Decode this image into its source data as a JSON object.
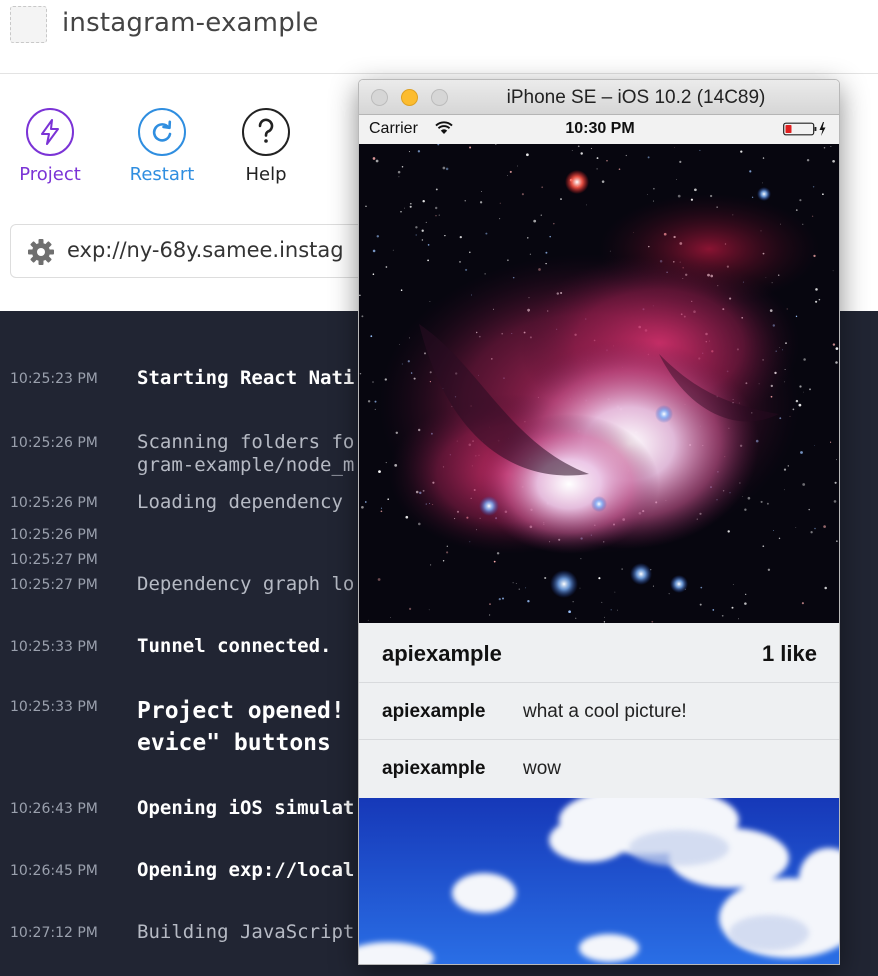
{
  "app": {
    "project_name": "instagram-example"
  },
  "toolbar": {
    "project_label": "Project",
    "restart_label": "Restart",
    "help_label": "Help",
    "url": "exp://ny-68y.samee.instag"
  },
  "colors": {
    "project_accent": "#7b33d6",
    "restart_accent": "#2f8ee0",
    "log_background": "#212533",
    "post_panel": "#eef0f2"
  },
  "log": [
    {
      "time": "10:25:23 PM",
      "lines": [
        "Starting React Nati"
      ],
      "style": "bold"
    },
    {
      "time": "10:25:26 PM",
      "lines": [
        "Scanning folders fo",
        "gram-example/node_m"
      ],
      "style": "dim"
    },
    {
      "time": "10:25:26 PM",
      "lines": [
        "Loading dependency "
      ],
      "style": "dim"
    },
    {
      "time": "10:25:26 PM",
      "lines": [
        ""
      ],
      "style": "dim"
    },
    {
      "time": "10:25:27 PM",
      "lines": [
        ""
      ],
      "style": "dim"
    },
    {
      "time": "10:25:27 PM",
      "lines": [
        "Dependency graph lo"
      ],
      "style": "dim"
    },
    {
      "time": "10:25:33 PM",
      "lines": [
        "Tunnel connected."
      ],
      "style": "bold"
    },
    {
      "time": "10:25:33 PM",
      "lines": [
        "Project opened!",
        "evice\" buttons "
      ],
      "style": "large"
    },
    {
      "time": "10:26:43 PM",
      "lines": [
        "Opening iOS simulat"
      ],
      "style": "bold"
    },
    {
      "time": "10:26:45 PM",
      "lines": [
        "Opening exp://local"
      ],
      "style": "bold"
    },
    {
      "time": "10:27:12 PM",
      "lines": [
        "Building JavaScript"
      ],
      "style": "dim"
    }
  ],
  "simulator": {
    "window_title": "iPhone SE – iOS 10.2 (14C89)",
    "carrier": "Carrier",
    "time": "10:30 PM",
    "icons": [
      "wifi-icon",
      "battery-icon",
      "charging-bolt-icon"
    ]
  },
  "post": {
    "username": "apiexample",
    "likes": "1 like",
    "comments": [
      {
        "user": "apiexample",
        "text": "what a cool picture!"
      },
      {
        "user": "apiexample",
        "text": "wow"
      }
    ]
  }
}
